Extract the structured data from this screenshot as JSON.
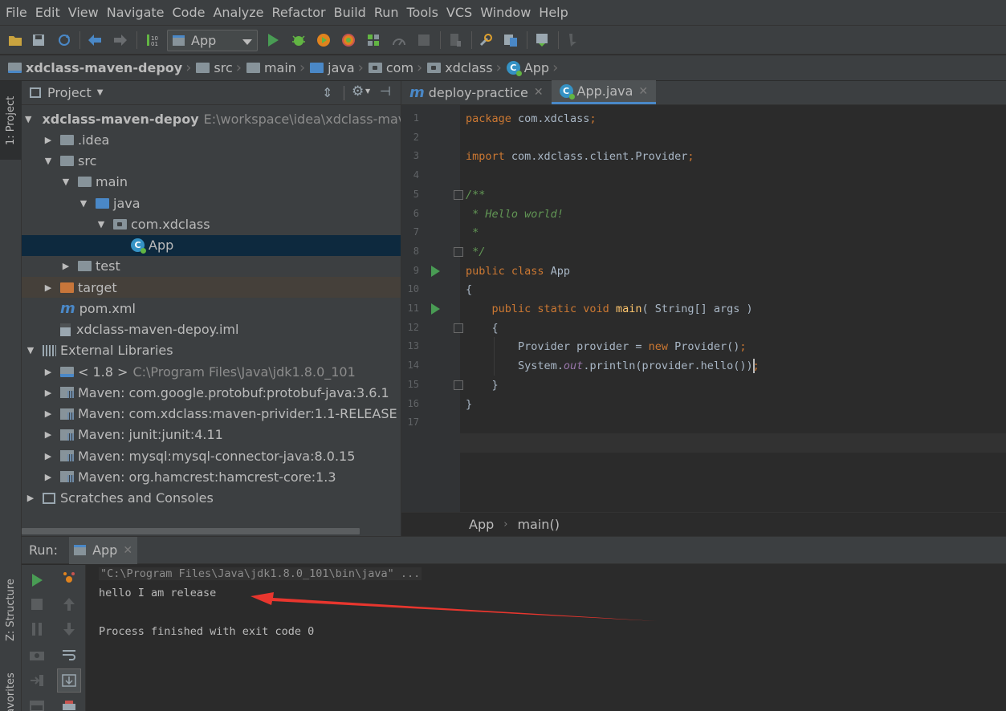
{
  "menubar": {
    "items": [
      "File",
      "Edit",
      "View",
      "Navigate",
      "Code",
      "Analyze",
      "Refactor",
      "Build",
      "Run",
      "Tools",
      "VCS",
      "Window",
      "Help"
    ]
  },
  "toolbar": {
    "run_config": "App"
  },
  "breadcrumbs": [
    {
      "label": "xdclass-maven-depoy",
      "icon": "module-folder-icon",
      "bold": true
    },
    {
      "label": "src",
      "icon": "folder-icon"
    },
    {
      "label": "main",
      "icon": "folder-icon"
    },
    {
      "label": "java",
      "icon": "source-folder-icon"
    },
    {
      "label": "com",
      "icon": "package-icon"
    },
    {
      "label": "xdclass",
      "icon": "package-icon"
    },
    {
      "label": "App",
      "icon": "class-icon"
    }
  ],
  "side_tabs": {
    "project": "1: Project",
    "structure": "Z: Structure",
    "favorites": "Favorites"
  },
  "project": {
    "title": "Project",
    "tree": [
      {
        "label": "xdclass-maven-depoy",
        "extra": "E:\\workspace\\idea\\xdclass-maven-",
        "depth": 0,
        "arrow": "down",
        "icon": "module-folder-icon",
        "bold": true
      },
      {
        "label": ".idea",
        "depth": 1,
        "arrow": "right",
        "icon": "folder-icon"
      },
      {
        "label": "src",
        "depth": 1,
        "arrow": "down",
        "icon": "folder-icon"
      },
      {
        "label": "main",
        "depth": 2,
        "arrow": "down",
        "icon": "folder-icon"
      },
      {
        "label": "java",
        "depth": 3,
        "arrow": "down",
        "icon": "source-folder-icon"
      },
      {
        "label": "com.xdclass",
        "depth": 4,
        "arrow": "down",
        "icon": "package-icon"
      },
      {
        "label": "App",
        "depth": 5,
        "arrow": "none",
        "icon": "class-icon",
        "selected": true
      },
      {
        "label": "test",
        "depth": 2,
        "arrow": "right",
        "icon": "folder-icon"
      },
      {
        "label": "target",
        "depth": 1,
        "arrow": "right",
        "icon": "excluded-folder-icon",
        "excluded": true
      },
      {
        "label": "pom.xml",
        "depth": 1,
        "arrow": "none",
        "icon": "maven-icon"
      },
      {
        "label": "xdclass-maven-depoy.iml",
        "depth": 1,
        "arrow": "none",
        "icon": "iml-file-icon"
      },
      {
        "label": "External Libraries",
        "depth": 0,
        "arrow": "down",
        "icon": "libraries-icon"
      },
      {
        "label": "< 1.8 >",
        "extra": "C:\\Program Files\\Java\\jdk1.8.0_101",
        "depth": 1,
        "arrow": "right",
        "icon": "jdk-icon"
      },
      {
        "label": "Maven: com.google.protobuf:protobuf-java:3.6.1",
        "depth": 1,
        "arrow": "right",
        "icon": "library-icon"
      },
      {
        "label": "Maven: com.xdclass:maven-privider:1.1-RELEASE",
        "depth": 1,
        "arrow": "right",
        "icon": "library-icon"
      },
      {
        "label": "Maven: junit:junit:4.11",
        "depth": 1,
        "arrow": "right",
        "icon": "library-icon"
      },
      {
        "label": "Maven: mysql:mysql-connector-java:8.0.15",
        "depth": 1,
        "arrow": "right",
        "icon": "library-icon"
      },
      {
        "label": "Maven: org.hamcrest:hamcrest-core:1.3",
        "depth": 1,
        "arrow": "right",
        "icon": "library-icon"
      },
      {
        "label": "Scratches and Consoles",
        "depth": 0,
        "arrow": "right",
        "icon": "scratches-icon"
      }
    ]
  },
  "editor": {
    "tabs": [
      {
        "label": "deploy-practice",
        "icon": "maven-icon",
        "active": false
      },
      {
        "label": "App.java",
        "icon": "class-icon",
        "active": true
      }
    ],
    "lines": [
      [
        {
          "t": "package ",
          "c": "kw"
        },
        {
          "t": "com.xdclass",
          "c": ""
        },
        {
          "t": ";",
          "c": "kw"
        }
      ],
      [],
      [
        {
          "t": "import ",
          "c": "kw"
        },
        {
          "t": "com.xdclass.client.Provider",
          "c": ""
        },
        {
          "t": ";",
          "c": "kw"
        }
      ],
      [],
      [
        {
          "t": "/**",
          "c": "cm"
        }
      ],
      [
        {
          "t": " * Hello world!",
          "c": "cm"
        }
      ],
      [
        {
          "t": " *",
          "c": "cm"
        }
      ],
      [
        {
          "t": " */",
          "c": "cm"
        }
      ],
      [
        {
          "t": "public class ",
          "c": "kw"
        },
        {
          "t": "App",
          "c": ""
        }
      ],
      [
        {
          "t": "{",
          "c": ""
        }
      ],
      [
        {
          "t": "    public static void ",
          "c": "kw"
        },
        {
          "t": "main",
          "c": "fn"
        },
        {
          "t": "( String[] args )",
          "c": ""
        }
      ],
      [
        {
          "t": "    {",
          "c": ""
        }
      ],
      [
        {
          "t": "        Provider provider = ",
          "c": ""
        },
        {
          "t": "new ",
          "c": "kw"
        },
        {
          "t": "Provider()",
          "c": ""
        },
        {
          "t": ";",
          "c": "kw"
        }
      ],
      [
        {
          "t": "        System.",
          "c": ""
        },
        {
          "t": "out",
          "c": "st"
        },
        {
          "t": ".println(provider.hello())",
          "c": ""
        },
        {
          "t": ";",
          "c": "kw"
        }
      ],
      [
        {
          "t": "    }",
          "c": ""
        }
      ],
      [
        {
          "t": "}",
          "c": ""
        }
      ],
      []
    ],
    "status": {
      "class": "App",
      "method": "main()"
    }
  },
  "run": {
    "label": "Run:",
    "tab": "App",
    "console": [
      {
        "text": "\"C:\\Program Files\\Java\\jdk1.8.0_101\\bin\\java\" ...",
        "kind": "cmd"
      },
      {
        "text": "hello I am release",
        "kind": "out"
      },
      {
        "text": "",
        "kind": "out"
      },
      {
        "text": "Process finished with exit code 0",
        "kind": "out"
      }
    ]
  },
  "colors": {
    "accent": "#4a88c7",
    "run_green": "#499c54",
    "annotation_arrow": "#e8362e"
  }
}
